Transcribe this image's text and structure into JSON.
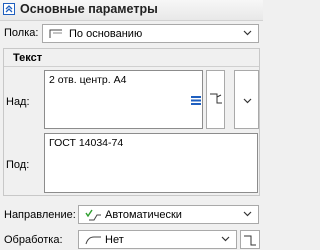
{
  "section": {
    "title": "Основные параметры"
  },
  "shelf": {
    "label": "Полка:",
    "value": "По основанию"
  },
  "text_group": {
    "title": "Текст",
    "above_label": "Над:",
    "above_value": "2 отв. центр. А4",
    "below_label": "Под:",
    "below_value": "ГОСТ 14034-74"
  },
  "direction": {
    "label": "Направление:",
    "value": "Автоматически"
  },
  "processing": {
    "label": "Обработка:",
    "value": "Нет"
  },
  "colors": {
    "accent": "#1f5fbf",
    "green_check": "#2e9e2e"
  }
}
